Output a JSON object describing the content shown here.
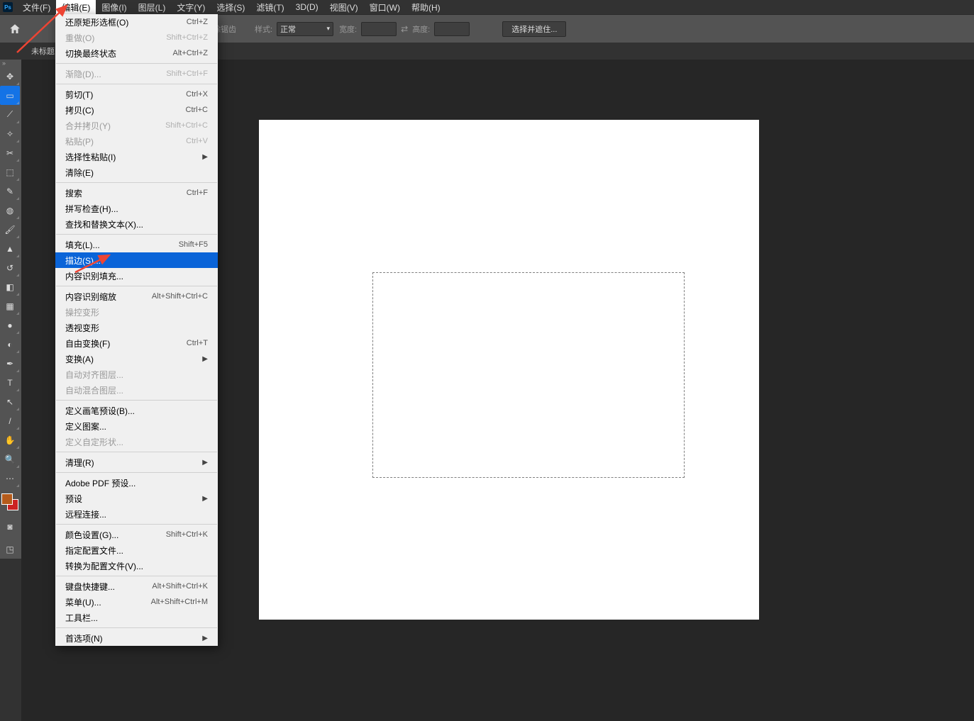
{
  "menubar": {
    "items": [
      {
        "label": "文件(F)"
      },
      {
        "label": "编辑(E)"
      },
      {
        "label": "图像(I)"
      },
      {
        "label": "图层(L)"
      },
      {
        "label": "文字(Y)"
      },
      {
        "label": "选择(S)"
      },
      {
        "label": "滤镜(T)"
      },
      {
        "label": "3D(D)"
      },
      {
        "label": "视图(V)"
      },
      {
        "label": "窗口(W)"
      },
      {
        "label": "帮助(H)"
      }
    ]
  },
  "optionsbar": {
    "clear_crosshair": "消除锯齿",
    "style_label": "样式:",
    "style_value": "正常",
    "width_label": "宽度:",
    "height_label": "高度:",
    "mask_btn": "选择并遮住..."
  },
  "doctab": "未标题",
  "tools": [
    {
      "name": "move-tool",
      "char": "✥"
    },
    {
      "name": "marquee-tool",
      "char": "▭",
      "sel": true
    },
    {
      "name": "lasso-tool",
      "char": "⟋"
    },
    {
      "name": "wand-tool",
      "char": "✧"
    },
    {
      "name": "crop-tool",
      "char": "✂"
    },
    {
      "name": "frame-tool",
      "char": "⬚"
    },
    {
      "name": "eyedropper-tool",
      "char": "✎"
    },
    {
      "name": "healing-tool",
      "char": "◍"
    },
    {
      "name": "brush-tool",
      "char": "🖌"
    },
    {
      "name": "stamp-tool",
      "char": "▲"
    },
    {
      "name": "history-brush-tool",
      "char": "↺"
    },
    {
      "name": "eraser-tool",
      "char": "◧"
    },
    {
      "name": "gradient-tool",
      "char": "▦"
    },
    {
      "name": "blur-tool",
      "char": "●"
    },
    {
      "name": "dodge-tool",
      "char": "◐"
    },
    {
      "name": "pen-tool",
      "char": "✒"
    },
    {
      "name": "type-tool",
      "char": "T"
    },
    {
      "name": "path-tool",
      "char": "↖"
    },
    {
      "name": "line-tool",
      "char": "/"
    },
    {
      "name": "hand-tool",
      "char": "✋"
    },
    {
      "name": "zoom-tool",
      "char": "🔍"
    },
    {
      "name": "more-tool",
      "char": "⋯"
    }
  ],
  "dropdown": {
    "groups": [
      [
        {
          "label": "还原矩形选框(O)",
          "sc": "Ctrl+Z",
          "d": false
        },
        {
          "label": "重做(O)",
          "sc": "Shift+Ctrl+Z",
          "d": true
        },
        {
          "label": "切换最终状态",
          "sc": "Alt+Ctrl+Z",
          "d": false
        }
      ],
      [
        {
          "label": "渐隐(D)...",
          "sc": "Shift+Ctrl+F",
          "d": true
        }
      ],
      [
        {
          "label": "剪切(T)",
          "sc": "Ctrl+X",
          "d": false
        },
        {
          "label": "拷贝(C)",
          "sc": "Ctrl+C",
          "d": false
        },
        {
          "label": "合并拷贝(Y)",
          "sc": "Shift+Ctrl+C",
          "d": true
        },
        {
          "label": "粘贴(P)",
          "sc": "Ctrl+V",
          "d": true
        },
        {
          "label": "选择性粘贴(I)",
          "sub": true,
          "d": false
        },
        {
          "label": "清除(E)",
          "d": false
        }
      ],
      [
        {
          "label": "搜索",
          "sc": "Ctrl+F",
          "d": false
        },
        {
          "label": "拼写检查(H)...",
          "d": false
        },
        {
          "label": "查找和替换文本(X)...",
          "d": false
        }
      ],
      [
        {
          "label": "填充(L)...",
          "sc": "Shift+F5",
          "d": false
        },
        {
          "label": "描边(S)...",
          "hl": true,
          "d": false
        },
        {
          "label": "内容识别填充...",
          "d": false
        }
      ],
      [
        {
          "label": "内容识别缩放",
          "sc": "Alt+Shift+Ctrl+C",
          "d": false
        },
        {
          "label": "操控变形",
          "d": true
        },
        {
          "label": "透视变形",
          "d": false
        },
        {
          "label": "自由变换(F)",
          "sc": "Ctrl+T",
          "d": false
        },
        {
          "label": "变换(A)",
          "sub": true,
          "d": false
        },
        {
          "label": "自动对齐图层...",
          "d": true
        },
        {
          "label": "自动混合图层...",
          "d": true
        }
      ],
      [
        {
          "label": "定义画笔预设(B)...",
          "d": false
        },
        {
          "label": "定义图案...",
          "d": false
        },
        {
          "label": "定义自定形状...",
          "d": true
        }
      ],
      [
        {
          "label": "清理(R)",
          "sub": true,
          "d": false
        }
      ],
      [
        {
          "label": "Adobe PDF 预设...",
          "d": false
        },
        {
          "label": "预设",
          "sub": true,
          "d": false
        },
        {
          "label": "远程连接...",
          "d": false
        }
      ],
      [
        {
          "label": "颜色设置(G)...",
          "sc": "Shift+Ctrl+K",
          "d": false
        },
        {
          "label": "指定配置文件...",
          "d": false
        },
        {
          "label": "转换为配置文件(V)...",
          "d": false
        }
      ],
      [
        {
          "label": "键盘快捷键...",
          "sc": "Alt+Shift+Ctrl+K",
          "d": false
        },
        {
          "label": "菜单(U)...",
          "sc": "Alt+Shift+Ctrl+M",
          "d": false
        },
        {
          "label": "工具栏...",
          "d": false
        }
      ],
      [
        {
          "label": "首选项(N)",
          "sub": true,
          "d": false
        }
      ]
    ]
  }
}
